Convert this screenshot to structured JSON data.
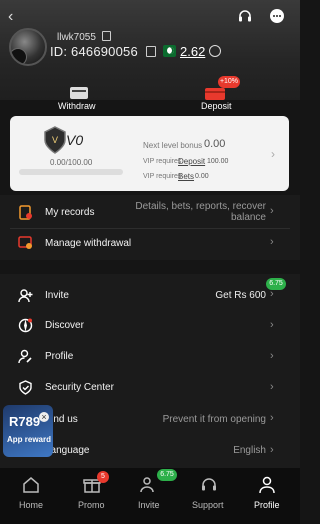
{
  "header": {
    "username": "llwk7055",
    "id_text": "ID: 646690056",
    "balance": "2.62"
  },
  "actions": {
    "withdraw": "Withdraw",
    "deposit": "Deposit",
    "deposit_badge": "+10%"
  },
  "vip": {
    "level": "V0",
    "progress_text": "0.00/100.00",
    "progress": 0.0,
    "next_level_label": "Next level bonus",
    "next_level_value": "0.00",
    "req_deposit_label": "VIP requires",
    "req_deposit_link": "Deposit",
    "req_deposit_value": "100.00",
    "req_bets_label": "VIP requires",
    "req_bets_link": "Bets",
    "req_bets_value": "0.00"
  },
  "menu_top": [
    {
      "label": "My records",
      "right_line1": "Details, bets, reports, recover",
      "right_line2": "balance"
    },
    {
      "label": "Manage withdrawal",
      "right_line1": "",
      "right_line2": ""
    }
  ],
  "menu_main": [
    {
      "label": "Invite",
      "right": "Get Rs 600",
      "badge": "6.75"
    },
    {
      "label": "Discover",
      "right": ""
    },
    {
      "label": "Profile",
      "right": ""
    },
    {
      "label": "Security Center",
      "right": ""
    },
    {
      "label": "Find us",
      "right": "Prevent it from opening"
    },
    {
      "label": "Language",
      "right": "English"
    }
  ],
  "float_banner": {
    "brand": "R789",
    "line": "App reward"
  },
  "nav": {
    "items": [
      {
        "label": "Home"
      },
      {
        "label": "Promo",
        "badge": "5"
      },
      {
        "label": "Invite",
        "badge": "6.75"
      },
      {
        "label": "Support"
      },
      {
        "label": "Profile"
      }
    ]
  },
  "colors": {
    "accent_red": "#e8392d",
    "accent_green": "#2db04a",
    "orange_icon": "#f39a2e"
  }
}
